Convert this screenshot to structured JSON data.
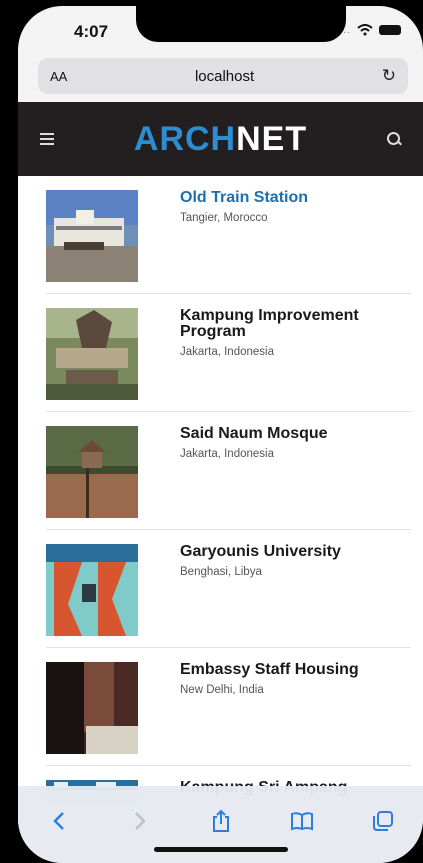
{
  "status": {
    "time": "4:07"
  },
  "browser": {
    "aa_label": "AA",
    "host": "localhost",
    "reload_symbol": "↻"
  },
  "header": {
    "logo_part1": "ARCH",
    "logo_part2": "NET"
  },
  "items": [
    {
      "title": "Old Train Station",
      "location": "Tangier, Morocco"
    },
    {
      "title": "Kampung Improvement Program",
      "location": "Jakarta, Indonesia"
    },
    {
      "title": "Said Naum Mosque",
      "location": "Jakarta, Indonesia"
    },
    {
      "title": "Garyounis University",
      "location": "Benghasi, Libya"
    },
    {
      "title": "Embassy Staff Housing",
      "location": "New Delhi, India"
    },
    {
      "title": "Kampung Sri Ampang",
      "location": ""
    }
  ],
  "colors": {
    "accent": "#2c8dd1",
    "navbar": "#231f20",
    "link": "#1c6fb0"
  },
  "toolbar_icons": [
    "back-icon",
    "forward-icon",
    "share-icon",
    "bookmarks-icon",
    "tabs-icon"
  ]
}
